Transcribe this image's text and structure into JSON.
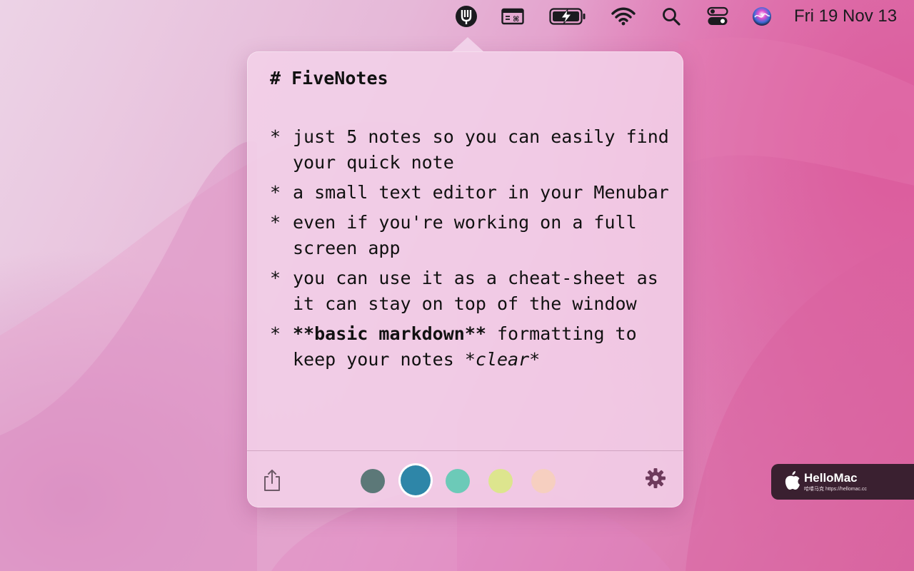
{
  "menubar": {
    "icons": [
      "fivenotes-icon",
      "keyboard-shortcut-icon",
      "battery-charging-icon",
      "wifi-icon",
      "search-icon",
      "control-center-icon",
      "siri-icon"
    ],
    "clock": "Fri 19 Nov  13"
  },
  "note": {
    "heading": "# FiveNotes",
    "bullet_marker": "*",
    "bullets": [
      "just 5 notes so you can easily find your quick note",
      "a small text editor in your Menubar",
      "even if you're working on a full screen app",
      "you can use it as a cheat-sheet as it can stay on top of the window"
    ],
    "last_bullet": {
      "bold_part": "**basic markdown**",
      "middle": " formatting to keep your notes ",
      "italic_part": "*clear*"
    }
  },
  "toolbar": {
    "share_icon": "share-icon",
    "settings_icon": "gear-icon",
    "swatches": [
      {
        "name": "slate",
        "color": "#5c7878"
      },
      {
        "name": "teal-blue",
        "color": "#2e86a8",
        "selected": true
      },
      {
        "name": "mint",
        "color": "#6ccab8"
      },
      {
        "name": "lime",
        "color": "#dde58e"
      },
      {
        "name": "peach",
        "color": "#f6cfc0"
      }
    ]
  },
  "watermark": {
    "title": "HelloMac",
    "subtitle": "哈喽马克 https://hellomac.cc"
  }
}
